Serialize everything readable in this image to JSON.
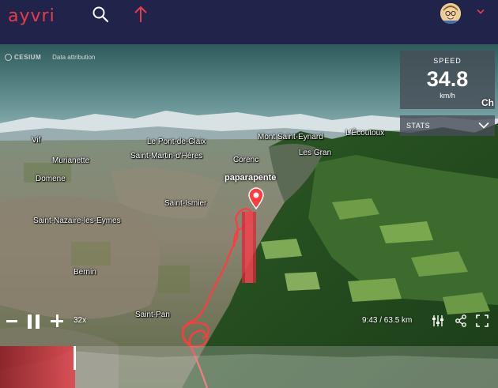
{
  "nav": {
    "logo": "ayvri",
    "icons": [
      "search-icon",
      "upload-arrow-icon",
      "user-avatar",
      "chevron-down-icon"
    ],
    "accent": "#ea3b4b",
    "bg": "#21244a"
  },
  "map": {
    "attribution": {
      "brand": "CESIUM",
      "link": "Data attribution"
    },
    "places": [
      "Vif",
      "Murianette",
      "Domene",
      "Le Pont-de-Claix",
      "Saint-Martin-d'Hères",
      "Mont Saint-Eynard",
      "L'Écoutoux",
      "Corenc",
      "Les Gran",
      "Saint-Ismier",
      "Saint-Nazaire-les-Eymes",
      "Bernin",
      "Saint-Pan"
    ],
    "pilot_label": "paparapente",
    "track_color": "#ff3b40",
    "edge_text": "Ch"
  },
  "speed_panel": {
    "label": "SPEED",
    "value": "34.8",
    "unit": "km/h"
  },
  "stats_bar": {
    "label": "STATS"
  },
  "playback": {
    "speed": "32x",
    "progress_text": "9:43 / 63.5 km",
    "progress_fraction": 0.15,
    "icons": [
      "zoom-out-icon",
      "pause-icon",
      "zoom-in-icon",
      "settings-sliders-icon",
      "share-icon",
      "fullscreen-icon"
    ]
  }
}
